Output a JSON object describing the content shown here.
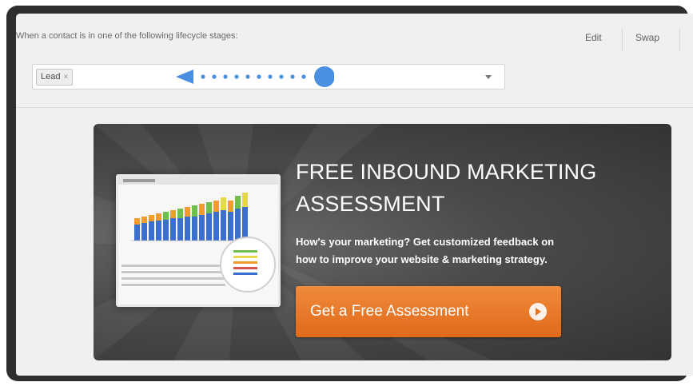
{
  "rule": {
    "condition_text": "When a contact is in one of the following lifecycle stages:"
  },
  "actions": {
    "edit_label": "Edit",
    "swap_label": "Swap"
  },
  "stage_select": {
    "tokens": [
      "Lead"
    ],
    "remove_glyph": "×"
  },
  "banner": {
    "headline_line1": "FREE INBOUND MARKETING",
    "headline_line2": "ASSESSMENT",
    "subtext_line1": "How's your marketing? Get customized feedback on",
    "subtext_line2": "how to improve your website & marketing strategy.",
    "cta_label": "Get a Free Assessment",
    "cta_icon": "play-circle-icon"
  },
  "colors": {
    "frame": "#2e2e2e",
    "panel": "#f0f0f0",
    "cta": "#e8772a",
    "annotation": "#4a90e2"
  }
}
